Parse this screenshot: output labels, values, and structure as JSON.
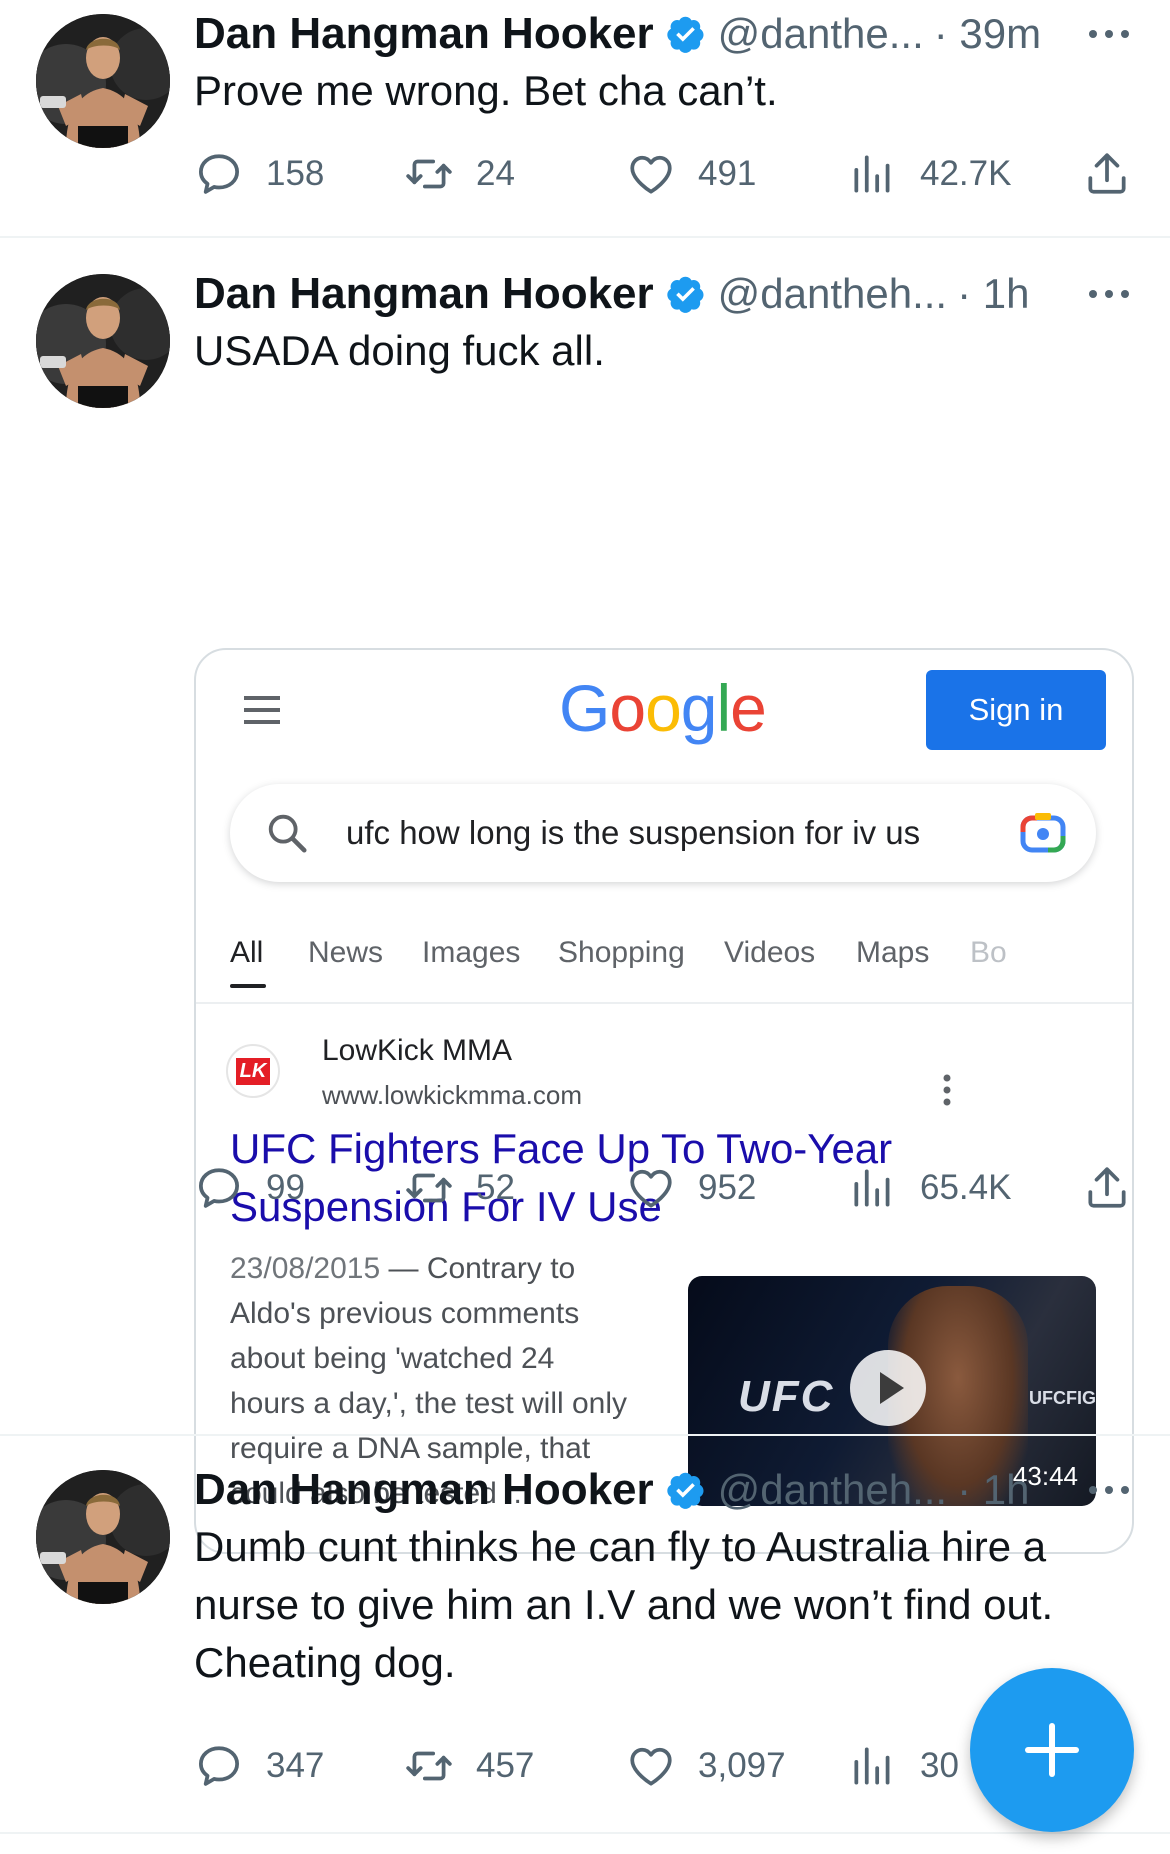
{
  "tweets": [
    {
      "name": "Dan Hangman Hooker",
      "handle": "@danthe...",
      "time": "· 39m",
      "text": "Prove me wrong. Bet cha can’t.",
      "replies": "158",
      "retweets": "24",
      "likes": "491",
      "views": "42.7K"
    },
    {
      "name": "Dan Hangman Hooker",
      "handle": "@dantheh...",
      "time": "· 1h",
      "text": "USADA doing fuck all.",
      "replies": "99",
      "retweets": "52",
      "likes": "952",
      "views": "65.4K"
    },
    {
      "name": "Dan Hangman Hooker",
      "handle": "@dantheh...",
      "time": "· 1h",
      "text": "Dumb cunt thinks he can fly to Australia hire a nurse to give him an I.V and we won’t find out. Cheating dog.",
      "replies": "347",
      "retweets": "457",
      "likes": "3,097",
      "views": "30"
    }
  ],
  "google_card": {
    "logo_letters": [
      "G",
      "o",
      "o",
      "g",
      "l",
      "e"
    ],
    "signin_label": "Sign in",
    "query": "ufc how long is the suspension for iv us",
    "tabs": [
      "All",
      "News",
      "Images",
      "Shopping",
      "Videos",
      "Maps",
      "Bo"
    ],
    "active_tab": "All",
    "result": {
      "site_logo_text": "LK",
      "site_name": "LowKick MMA",
      "site_url": "www.lowkickmma.com",
      "title": "UFC Fighters Face Up To Two-Year Suspension For IV Use",
      "date": "23/08/2015",
      "snippet": " — Contrary to Aldo's previous comments about being 'watched 24 hours a day,', the test will only require a DNA sample, that could also be tested ...",
      "video_brand": "UFC",
      "video_brand_right": "UFCFIG",
      "video_duration": "43:44"
    }
  },
  "colors": {
    "accent": "#1d9bf0",
    "google_blue": "#1a73e8",
    "link": "#1a0dab",
    "muted": "#536471"
  },
  "icons": [
    "verified-badge-icon",
    "more-icon",
    "reply-icon",
    "retweet-icon",
    "like-icon",
    "views-icon",
    "share-icon",
    "hamburger-icon",
    "search-icon",
    "lens-icon",
    "kebab-icon",
    "play-icon",
    "compose-plus-icon"
  ]
}
